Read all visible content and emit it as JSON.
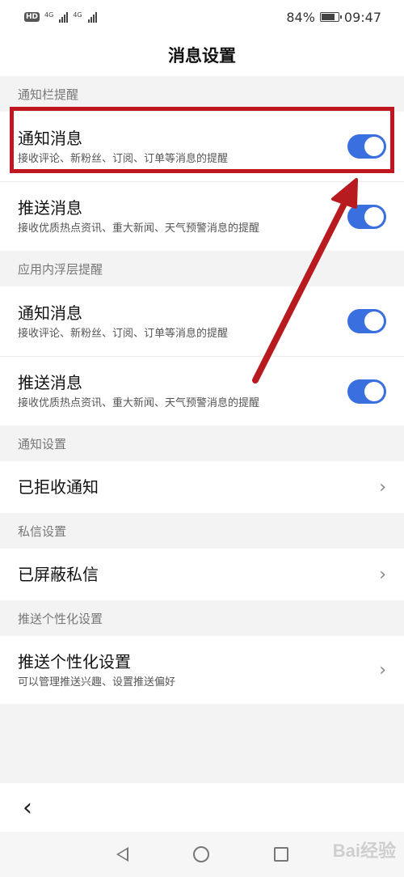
{
  "status_bar": {
    "hd": "HD",
    "sim1": "4G",
    "sim2": "4G",
    "battery": "84%",
    "time": "09:47"
  },
  "page_title": "消息设置",
  "sections": [
    {
      "header": "通知栏提醒",
      "rows": [
        {
          "title": "通知消息",
          "subtitle": "接收评论、新粉丝、订阅、订单等消息的提醒",
          "toggle_on": true
        },
        {
          "title": "推送消息",
          "subtitle": "接收优质热点资讯、重大新闻、天气预警消息的提醒",
          "toggle_on": true
        }
      ]
    },
    {
      "header": "应用内浮层提醒",
      "rows": [
        {
          "title": "通知消息",
          "subtitle": "接收评论、新粉丝、订阅、订单等消息的提醒",
          "toggle_on": true
        },
        {
          "title": "推送消息",
          "subtitle": "接收优质热点资讯、重大新闻、天气预警消息的提醒",
          "toggle_on": true
        }
      ]
    },
    {
      "header": "通知设置",
      "rows": [
        {
          "title": "已拒收通知"
        }
      ]
    },
    {
      "header": "私信设置",
      "rows": [
        {
          "title": "已屏蔽私信"
        }
      ]
    },
    {
      "header": "推送个性化设置",
      "rows": [
        {
          "title": "推送个性化设置",
          "subtitle": "可以管理推送兴趣、设置推送偏好"
        }
      ]
    }
  ],
  "icons": {
    "back": "‹",
    "chevron": "›"
  },
  "watermark": "Bai经验",
  "colors": {
    "toggle_on": "#3a6fe0",
    "annotation": "#c0161f"
  }
}
